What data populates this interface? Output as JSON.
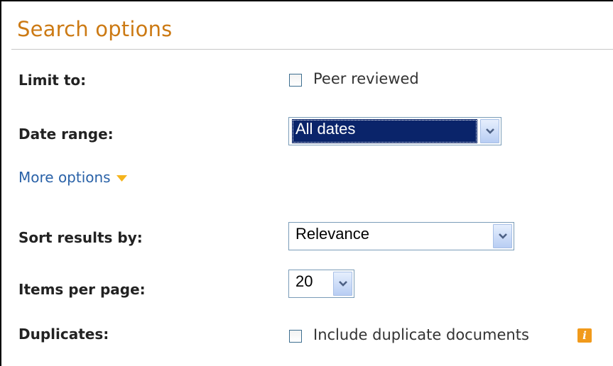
{
  "panel": {
    "title": "Search options"
  },
  "limit_to": {
    "label": "Limit to:",
    "peer_reviewed_label": "Peer reviewed",
    "peer_reviewed_checked": false
  },
  "date_range": {
    "label": "Date range:",
    "selected": "All dates"
  },
  "more_options": {
    "label": "More options",
    "icon": "triangle-down-icon"
  },
  "sort": {
    "label": "Sort results by:",
    "selected": "Relevance"
  },
  "items_per_page": {
    "label": "Items per page:",
    "selected": "20"
  },
  "duplicates": {
    "label": "Duplicates:",
    "include_label": "Include duplicate documents",
    "include_checked": false,
    "info_icon": "info-icon"
  },
  "colors": {
    "title": "#cc7a14",
    "link": "#2a62a8",
    "selection": "#0a246a",
    "info_badge": "#f19a1b"
  }
}
